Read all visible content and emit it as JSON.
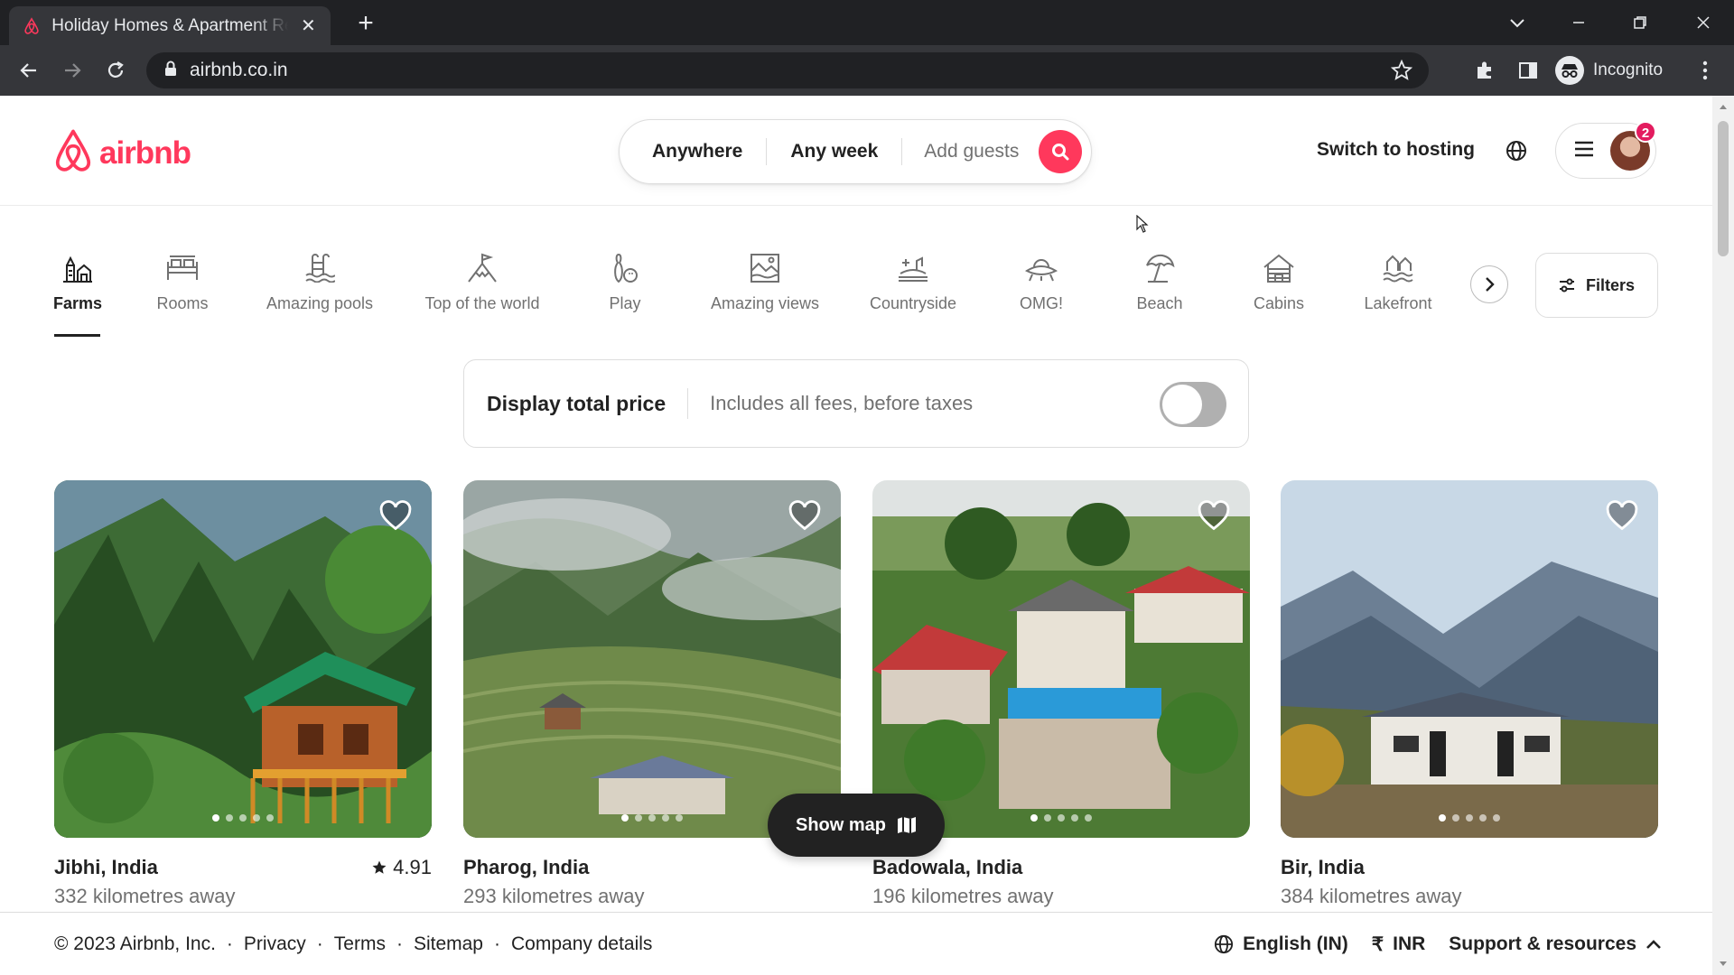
{
  "browser": {
    "tab_title": "Holiday Homes & Apartment Rentals - Airbnb",
    "url": "airbnb.co.in",
    "profile_label": "Incognito"
  },
  "header": {
    "brand": "airbnb",
    "search": {
      "where": "Anywhere",
      "when": "Any week",
      "guests": "Add guests"
    },
    "switch_hosting": "Switch to hosting",
    "notification_count": "2"
  },
  "categories": [
    {
      "label": "Farms",
      "icon": "farms-icon",
      "active": true
    },
    {
      "label": "Rooms",
      "icon": "rooms-icon"
    },
    {
      "label": "Amazing pools",
      "icon": "pool-icon"
    },
    {
      "label": "Top of the world",
      "icon": "mountain-flag-icon"
    },
    {
      "label": "Play",
      "icon": "bowling-icon"
    },
    {
      "label": "Amazing views",
      "icon": "views-icon"
    },
    {
      "label": "Countryside",
      "icon": "countryside-icon"
    },
    {
      "label": "OMG!",
      "icon": "ufo-icon"
    },
    {
      "label": "Beach",
      "icon": "umbrella-icon"
    },
    {
      "label": "Cabins",
      "icon": "cabin-icon"
    },
    {
      "label": "Lakefront",
      "icon": "lakefront-icon"
    }
  ],
  "filters_label": "Filters",
  "price_toggle": {
    "title": "Display total price",
    "subtitle": "Includes all fees, before taxes",
    "enabled": false
  },
  "listings": [
    {
      "title": "Jibhi, India",
      "distance": "332 kilometres away",
      "rating": "4.91"
    },
    {
      "title": "Pharog, India",
      "distance": "293 kilometres away",
      "rating": ""
    },
    {
      "title": "Badowala, India",
      "distance": "196 kilometres away",
      "rating": ""
    },
    {
      "title": "Bir, India",
      "distance": "384 kilometres away",
      "rating": ""
    }
  ],
  "show_map": "Show map",
  "footer": {
    "copyright": "© 2023 Airbnb, Inc.",
    "links": [
      "Privacy",
      "Terms",
      "Sitemap",
      "Company details"
    ],
    "language": "English (IN)",
    "currency_symbol": "₹",
    "currency": "INR",
    "support": "Support & resources"
  },
  "colors": {
    "brand": "#ff385c",
    "text": "#222222",
    "muted": "#717171",
    "chrome_dark": "#202124",
    "chrome_toolbar": "#35363a"
  }
}
